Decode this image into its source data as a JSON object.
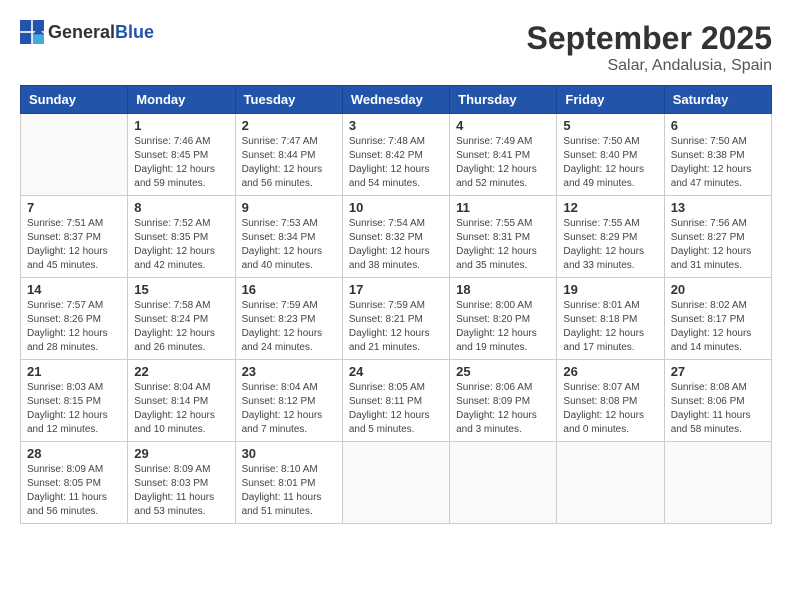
{
  "header": {
    "logo_general": "General",
    "logo_blue": "Blue",
    "month_year": "September 2025",
    "location": "Salar, Andalusia, Spain"
  },
  "days_of_week": [
    "Sunday",
    "Monday",
    "Tuesday",
    "Wednesday",
    "Thursday",
    "Friday",
    "Saturday"
  ],
  "weeks": [
    [
      {
        "day": "",
        "info": ""
      },
      {
        "day": "1",
        "info": "Sunrise: 7:46 AM\nSunset: 8:45 PM\nDaylight: 12 hours\nand 59 minutes."
      },
      {
        "day": "2",
        "info": "Sunrise: 7:47 AM\nSunset: 8:44 PM\nDaylight: 12 hours\nand 56 minutes."
      },
      {
        "day": "3",
        "info": "Sunrise: 7:48 AM\nSunset: 8:42 PM\nDaylight: 12 hours\nand 54 minutes."
      },
      {
        "day": "4",
        "info": "Sunrise: 7:49 AM\nSunset: 8:41 PM\nDaylight: 12 hours\nand 52 minutes."
      },
      {
        "day": "5",
        "info": "Sunrise: 7:50 AM\nSunset: 8:40 PM\nDaylight: 12 hours\nand 49 minutes."
      },
      {
        "day": "6",
        "info": "Sunrise: 7:50 AM\nSunset: 8:38 PM\nDaylight: 12 hours\nand 47 minutes."
      }
    ],
    [
      {
        "day": "7",
        "info": "Sunrise: 7:51 AM\nSunset: 8:37 PM\nDaylight: 12 hours\nand 45 minutes."
      },
      {
        "day": "8",
        "info": "Sunrise: 7:52 AM\nSunset: 8:35 PM\nDaylight: 12 hours\nand 42 minutes."
      },
      {
        "day": "9",
        "info": "Sunrise: 7:53 AM\nSunset: 8:34 PM\nDaylight: 12 hours\nand 40 minutes."
      },
      {
        "day": "10",
        "info": "Sunrise: 7:54 AM\nSunset: 8:32 PM\nDaylight: 12 hours\nand 38 minutes."
      },
      {
        "day": "11",
        "info": "Sunrise: 7:55 AM\nSunset: 8:31 PM\nDaylight: 12 hours\nand 35 minutes."
      },
      {
        "day": "12",
        "info": "Sunrise: 7:55 AM\nSunset: 8:29 PM\nDaylight: 12 hours\nand 33 minutes."
      },
      {
        "day": "13",
        "info": "Sunrise: 7:56 AM\nSunset: 8:27 PM\nDaylight: 12 hours\nand 31 minutes."
      }
    ],
    [
      {
        "day": "14",
        "info": "Sunrise: 7:57 AM\nSunset: 8:26 PM\nDaylight: 12 hours\nand 28 minutes."
      },
      {
        "day": "15",
        "info": "Sunrise: 7:58 AM\nSunset: 8:24 PM\nDaylight: 12 hours\nand 26 minutes."
      },
      {
        "day": "16",
        "info": "Sunrise: 7:59 AM\nSunset: 8:23 PM\nDaylight: 12 hours\nand 24 minutes."
      },
      {
        "day": "17",
        "info": "Sunrise: 7:59 AM\nSunset: 8:21 PM\nDaylight: 12 hours\nand 21 minutes."
      },
      {
        "day": "18",
        "info": "Sunrise: 8:00 AM\nSunset: 8:20 PM\nDaylight: 12 hours\nand 19 minutes."
      },
      {
        "day": "19",
        "info": "Sunrise: 8:01 AM\nSunset: 8:18 PM\nDaylight: 12 hours\nand 17 minutes."
      },
      {
        "day": "20",
        "info": "Sunrise: 8:02 AM\nSunset: 8:17 PM\nDaylight: 12 hours\nand 14 minutes."
      }
    ],
    [
      {
        "day": "21",
        "info": "Sunrise: 8:03 AM\nSunset: 8:15 PM\nDaylight: 12 hours\nand 12 minutes."
      },
      {
        "day": "22",
        "info": "Sunrise: 8:04 AM\nSunset: 8:14 PM\nDaylight: 12 hours\nand 10 minutes."
      },
      {
        "day": "23",
        "info": "Sunrise: 8:04 AM\nSunset: 8:12 PM\nDaylight: 12 hours\nand 7 minutes."
      },
      {
        "day": "24",
        "info": "Sunrise: 8:05 AM\nSunset: 8:11 PM\nDaylight: 12 hours\nand 5 minutes."
      },
      {
        "day": "25",
        "info": "Sunrise: 8:06 AM\nSunset: 8:09 PM\nDaylight: 12 hours\nand 3 minutes."
      },
      {
        "day": "26",
        "info": "Sunrise: 8:07 AM\nSunset: 8:08 PM\nDaylight: 12 hours\nand 0 minutes."
      },
      {
        "day": "27",
        "info": "Sunrise: 8:08 AM\nSunset: 8:06 PM\nDaylight: 11 hours\nand 58 minutes."
      }
    ],
    [
      {
        "day": "28",
        "info": "Sunrise: 8:09 AM\nSunset: 8:05 PM\nDaylight: 11 hours\nand 56 minutes."
      },
      {
        "day": "29",
        "info": "Sunrise: 8:09 AM\nSunset: 8:03 PM\nDaylight: 11 hours\nand 53 minutes."
      },
      {
        "day": "30",
        "info": "Sunrise: 8:10 AM\nSunset: 8:01 PM\nDaylight: 11 hours\nand 51 minutes."
      },
      {
        "day": "",
        "info": ""
      },
      {
        "day": "",
        "info": ""
      },
      {
        "day": "",
        "info": ""
      },
      {
        "day": "",
        "info": ""
      }
    ]
  ]
}
